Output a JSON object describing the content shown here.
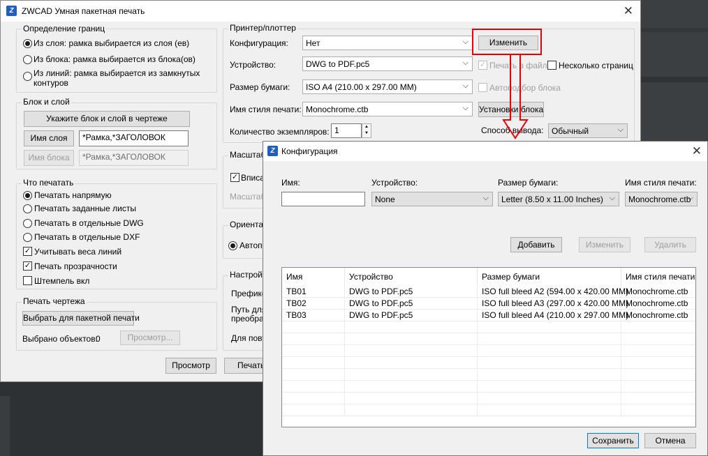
{
  "main_window": {
    "title": "ZWCAD Умная пакетная печать",
    "boundary": {
      "title": "Определение границ",
      "options": [
        "Из слоя: рамка выбирается из слоя (ев)",
        "Из блока: рамка выбирается из блока(ов)",
        "Из линий: рамка выбирается из замкнутых",
        "контуров"
      ],
      "selected": 0
    },
    "block_layer": {
      "title": "Блок и слой",
      "pick_button": "Укажите блок и слой в чертеже",
      "layer_button": "Имя слоя",
      "layer_value": "*Рамка,*ЗАГОЛОВОК",
      "block_button": "Имя блока",
      "block_value": "*Рамка,*ЗАГОЛОВОК"
    },
    "what_to_print": {
      "title": "Что печатать",
      "radios": [
        "Печатать напрямую",
        "Печатать заданные листы",
        "Печатать в отдельные DWG",
        "Печатать в отдельные DXF"
      ],
      "selected": 0,
      "checks": [
        {
          "label": "Учитывать веса линий",
          "checked": true
        },
        {
          "label": "Печать прозрачности",
          "checked": true
        },
        {
          "label": "Штемпель вкл",
          "checked": false
        }
      ]
    },
    "drawing_print": {
      "title": "Печать чертежа",
      "select_button": "Выбрать для пакетной печати",
      "selected_count_label": "Выбрано объектов:",
      "selected_count": "0",
      "preview_button": "Просмотр..."
    },
    "bottom_buttons": {
      "preview": "Просмотр",
      "print": "Печать"
    },
    "printer": {
      "title": "Принтер/плоттер",
      "config_label": "Конфигурация:",
      "config_value": "Нет",
      "change_button": "Изменить",
      "device_label": "Устройство:",
      "device_value": "DWG to PDF.pc5",
      "print_to_file": "Печать в файл",
      "multi_pages": "Несколько страниц",
      "paper_label": "Размер бумаги:",
      "paper_value": "ISO A4 (210.00 x 297.00 MM)",
      "auto_block": "Автоподбор блока",
      "style_label": "Имя стиля печати:",
      "style_value": "Monochrome.ctb",
      "block_settings_button": "Установки блока",
      "copies_label": "Количество экземпляров:",
      "copies_value": "1",
      "output_label": "Способ вывода:",
      "output_value": "Обычный"
    },
    "partial": {
      "scale_title": "Масштаб",
      "fit": "Вписа",
      "scale_label": "Масштаб",
      "orient_title": "Ориента",
      "auto": "Автопо",
      "settings_title": "Настрой",
      "prefix": "Префикс",
      "path1": "Путь для",
      "path2": "преобраз",
      "repeat": "Для повт"
    }
  },
  "config_dialog": {
    "title": "Конфигурация",
    "name_label": "Имя:",
    "name_value": "",
    "device_label": "Устройство:",
    "device_value": "None",
    "paper_label": "Размер бумаги:",
    "paper_value": "Letter (8.50 x 11.00 Inches)",
    "style_label": "Имя стиля печати:",
    "style_value": "Monochrome.ctb",
    "add_button": "Добавить",
    "change_button": "Изменить",
    "delete_button": "Удалить",
    "columns": [
      "Имя",
      "Устройство",
      "Размер бумаги",
      "Имя стиля печати"
    ],
    "rows": [
      [
        "TB01",
        "DWG to PDF.pc5",
        "ISO full bleed A2 (594.00 x 420.00 MM)",
        "Monochrome.ctb"
      ],
      [
        "TB02",
        "DWG to PDF.pc5",
        "ISO full bleed A3 (297.00 x 420.00 MM)",
        "Monochrome.ctb"
      ],
      [
        "TB03",
        "DWG to PDF.pc5",
        "ISO full bleed A4 (210.00 x 297.00 MM)",
        "Monochrome.ctb"
      ]
    ],
    "save_button": "Сохранить",
    "cancel_button": "Отмена"
  },
  "colors": {
    "annotation": "#e60000",
    "logo": "#1f5fbf",
    "dark_bg": "#2b2b2b"
  }
}
